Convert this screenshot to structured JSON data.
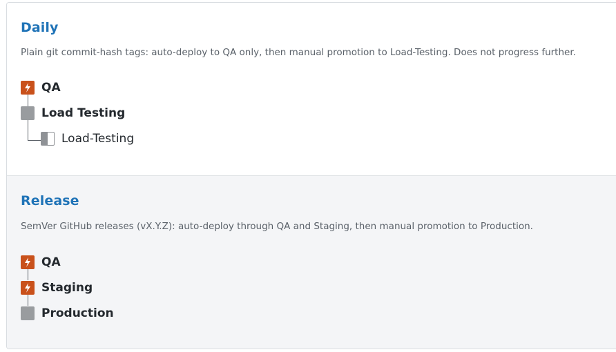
{
  "colors": {
    "title": "#1f73b7",
    "auto_icon": "#c9511b",
    "manual_icon": "#999c9f",
    "release_bg": "#f4f5f7"
  },
  "pipelines": [
    {
      "title": "Daily",
      "description": "Plain git commit-hash tags: auto-deploy to QA only, then manual promotion to Load-Testing. Does not progress further.",
      "stages": [
        {
          "label": "QA",
          "icon": "lightning-icon"
        },
        {
          "label": "Load Testing",
          "icon": "manual-stage-icon"
        },
        {
          "label": "Load-Testing",
          "icon": "half-filled-square-icon"
        }
      ]
    },
    {
      "title": "Release",
      "description": "SemVer GitHub releases (vX.Y.Z): auto-deploy through QA and Staging, then manual promotion to Production.",
      "stages": [
        {
          "label": "QA",
          "icon": "lightning-icon"
        },
        {
          "label": "Staging",
          "icon": "lightning-icon"
        },
        {
          "label": "Production",
          "icon": "manual-stage-icon"
        }
      ]
    }
  ]
}
